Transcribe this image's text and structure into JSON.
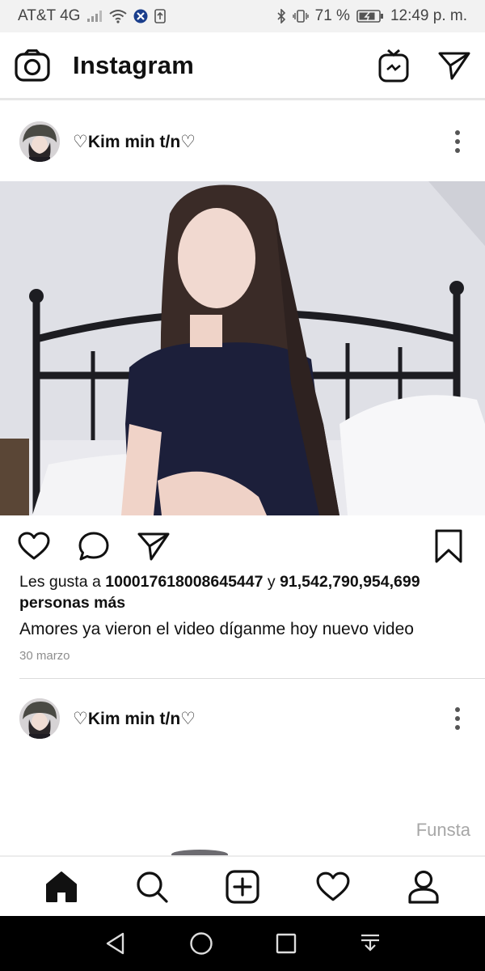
{
  "status_bar": {
    "carrier": "AT&T 4G",
    "battery": "71 %",
    "time": "12:49 p. m."
  },
  "header": {
    "title": "Instagram"
  },
  "posts": [
    {
      "username": "♡Kim min t/n♡",
      "likes_prefix": "Les gusta a ",
      "likes_user": "100017618008645447",
      "likes_middle": " y ",
      "likes_count": "91,542,790,954,699",
      "likes_suffix_bold": "personas más",
      "caption": "Amores ya vieron el video díganme hoy nuevo video",
      "date": "30 marzo"
    },
    {
      "username": "♡Kim min t/n♡"
    }
  ],
  "watermark": "Funsta",
  "icons": {
    "header_left": "camera-icon",
    "header_right": [
      "igtv-icon",
      "direct-message-icon"
    ],
    "post_actions": [
      "heart-icon",
      "comment-icon",
      "share-icon",
      "bookmark-icon"
    ],
    "bottom_nav": [
      "home-icon",
      "search-icon",
      "add-post-icon",
      "activity-heart-icon",
      "profile-icon"
    ],
    "system_nav": [
      "back-icon",
      "home-circle-icon",
      "recents-icon",
      "notification-pull-icon"
    ]
  },
  "colors": {
    "status_bar_bg": "#f2f2f2",
    "system_nav_bg": "#000000",
    "meta_text": "#8e8e8e",
    "watermark": "#a7a7a7"
  }
}
